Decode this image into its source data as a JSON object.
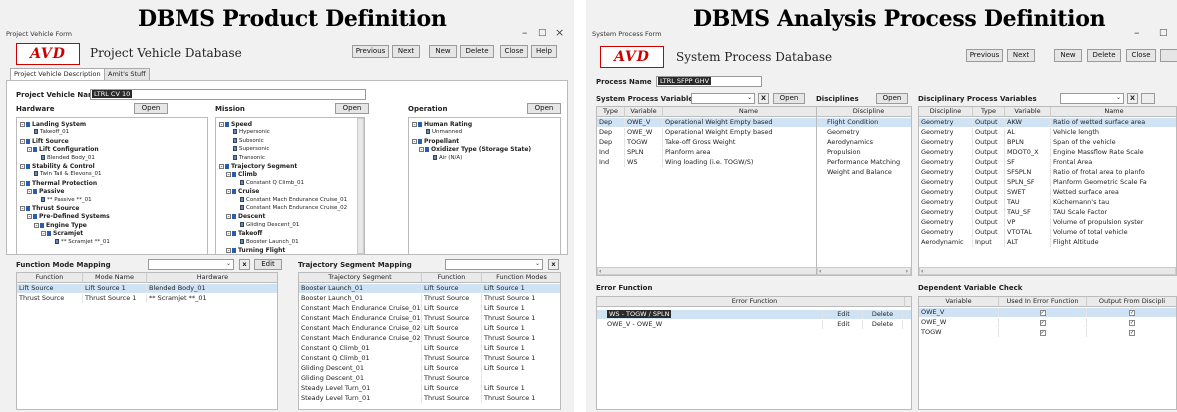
{
  "left": {
    "slide_title": "DBMS Product Definition",
    "window_title": "Project Vehicle Form",
    "logo": "AVD",
    "app_name": "Project Vehicle Database",
    "buttons": [
      "Previous",
      "Next",
      "New",
      "Delete",
      "Close",
      "Help"
    ],
    "tabs": [
      "Project Vehicle Description",
      "Amit's Stuff"
    ],
    "vehicle_name_label": "Project Vehicle Name",
    "vehicle_name_value": "LTRL CV 10",
    "hardware": {
      "label": "Hardware",
      "open": "Open",
      "nodes": [
        {
          "t": "Landing System",
          "d": 0,
          "b": true
        },
        {
          "t": "Takeoff_01",
          "d": 2,
          "b": false
        },
        {
          "t": "Lift Source",
          "d": 0,
          "b": true
        },
        {
          "t": "Lift Configuration",
          "d": 1,
          "b": true
        },
        {
          "t": "Blended Body_01",
          "d": 3,
          "b": false
        },
        {
          "t": "Stability & Control",
          "d": 0,
          "b": true
        },
        {
          "t": "Twin Tail & Elevons_01",
          "d": 2,
          "b": false
        },
        {
          "t": "Thermal Protection",
          "d": 0,
          "b": true
        },
        {
          "t": "Passive",
          "d": 1,
          "b": true
        },
        {
          "t": "** Passive **_01",
          "d": 3,
          "b": false
        },
        {
          "t": "Thrust Source",
          "d": 0,
          "b": true
        },
        {
          "t": "Pre-Defined Systems",
          "d": 1,
          "b": true
        },
        {
          "t": "Engine Type",
          "d": 2,
          "b": true
        },
        {
          "t": "Scramjet",
          "d": 3,
          "b": true
        },
        {
          "t": "** Scramjet **_01",
          "d": 5,
          "b": false
        }
      ]
    },
    "mission": {
      "label": "Mission",
      "open": "Open",
      "nodes": [
        {
          "t": "Speed",
          "d": 0,
          "b": true
        },
        {
          "t": "Hypersonic",
          "d": 2,
          "b": false
        },
        {
          "t": "Subsonic",
          "d": 2,
          "b": false
        },
        {
          "t": "Supersonic",
          "d": 2,
          "b": false
        },
        {
          "t": "Transonic",
          "d": 2,
          "b": false
        },
        {
          "t": "Trajectory Segment",
          "d": 0,
          "b": true
        },
        {
          "t": "Climb",
          "d": 1,
          "b": true
        },
        {
          "t": "Constant Q Climb_01",
          "d": 3,
          "b": false
        },
        {
          "t": "Cruise",
          "d": 1,
          "b": true
        },
        {
          "t": "Constant Mach Endurance Cruise_01",
          "d": 3,
          "b": false
        },
        {
          "t": "Constant Mach Endurance Cruise_02",
          "d": 3,
          "b": false
        },
        {
          "t": "Descent",
          "d": 1,
          "b": true
        },
        {
          "t": "Gliding Descent_01",
          "d": 3,
          "b": false
        },
        {
          "t": "Takeoff",
          "d": 1,
          "b": true
        },
        {
          "t": "Booster Launch_01",
          "d": 3,
          "b": false
        },
        {
          "t": "Turning Flight",
          "d": 1,
          "b": true
        }
      ]
    },
    "operation": {
      "label": "Operation",
      "open": "Open",
      "nodes": [
        {
          "t": "Human Rating",
          "d": 0,
          "b": true
        },
        {
          "t": "Unmanned",
          "d": 2,
          "b": false
        },
        {
          "t": "Propellant",
          "d": 0,
          "b": true
        },
        {
          "t": "Oxidizer Type (Storage State)",
          "d": 1,
          "b": true
        },
        {
          "t": "Air (N/A)",
          "d": 3,
          "b": false
        }
      ]
    },
    "fmm": {
      "label": "Function Mode Mapping",
      "x": "x",
      "edit": "Edit",
      "headers": [
        "Function",
        "Mode Name",
        "Hardware"
      ],
      "rows": [
        [
          "Lift Source",
          "Lift Source 1",
          "Blended Body_01"
        ],
        [
          "Thrust Source",
          "Thrust Source 1",
          "** Scramjet **_01"
        ]
      ]
    },
    "tsm": {
      "label": "Trajectory Segment Mapping",
      "x": "x",
      "headers": [
        "Trajectory Segment",
        "Function",
        "Function Modes"
      ],
      "rows": [
        [
          "Booster Launch_01",
          "Lift Source",
          "Lift Source 1"
        ],
        [
          "Booster Launch_01",
          "Thrust Source",
          "Thrust Source 1"
        ],
        [
          "Constant Mach Endurance Cruise_01",
          "Lift Source",
          "Lift Source 1"
        ],
        [
          "Constant Mach Endurance Cruise_01",
          "Thrust Source",
          "Thrust Source 1"
        ],
        [
          "Constant Mach Endurance Cruise_02",
          "Lift Source",
          "Lift Source 1"
        ],
        [
          "Constant Mach Endurance Cruise_02",
          "Thrust Source",
          "Thrust Source 1"
        ],
        [
          "Constant Q Climb_01",
          "Lift Source",
          "Lift Source 1"
        ],
        [
          "Constant Q Climb_01",
          "Thrust Source",
          "Thrust Source 1"
        ],
        [
          "Gliding Descent_01",
          "Lift Source",
          "Lift Source 1"
        ],
        [
          "Gliding Descent_01",
          "Thrust Source",
          ""
        ],
        [
          "Steady Level Turn_01",
          "Lift Source",
          "Lift Source 1"
        ],
        [
          "Steady Level Turn_01",
          "Thrust Source",
          "Thrust Source 1"
        ]
      ]
    }
  },
  "right": {
    "slide_title": "DBMS Analysis Process Definition",
    "window_title": "System Process Form",
    "logo": "AVD",
    "app_name": "System Process Database",
    "buttons": [
      "Previous",
      "Next",
      "New",
      "Delete",
      "Close"
    ],
    "process_name_label": "Process Name",
    "process_name_value": "LTRL SFPP GHV",
    "spv": {
      "label": "System Process Variables",
      "x": "X",
      "open": "Open",
      "headers": [
        "Type",
        "Variable",
        "Name"
      ],
      "rows": [
        [
          "Dep",
          "OWE_V",
          "Operational Weight Empty based"
        ],
        [
          "Dep",
          "OWE_W",
          "Operational Weight Empty based"
        ],
        [
          "Dep",
          "TOGW",
          "Take-off Gross Weight"
        ],
        [
          "Ind",
          "SPLN",
          "Planform area"
        ],
        [
          "Ind",
          "WS",
          "Wing loading (i.e. TOGW/S)"
        ]
      ]
    },
    "disc": {
      "label": "Disciplines",
      "open": "Open",
      "headers": [
        "Discipline"
      ],
      "rows": [
        "Flight Condition",
        "Geometry",
        "Aerodynamics",
        "Propulsion",
        "Performance Matching",
        "Weight and Balance"
      ]
    },
    "dpv": {
      "label": "Disciplinary Process Variables",
      "x": "X",
      "headers": [
        "Discipline",
        "Type",
        "Variable",
        "Name"
      ],
      "rows": [
        [
          "Geometry",
          "Output",
          "AKW",
          "Ratio of wetted surface area"
        ],
        [
          "Geometry",
          "Output",
          "AL",
          "Vehicle length"
        ],
        [
          "Geometry",
          "Output",
          "BPLN",
          "Span of the vehicle"
        ],
        [
          "Geometry",
          "Output",
          "MDOT0_X",
          "Engine Massflow Rate Scale"
        ],
        [
          "Geometry",
          "Output",
          "SF",
          "Frontal Area"
        ],
        [
          "Geometry",
          "Output",
          "SFSPLN",
          "Ratio of frotal area to planfo"
        ],
        [
          "Geometry",
          "Output",
          "SPLN_SF",
          "Planform Geometric Scale Fa"
        ],
        [
          "Geometry",
          "Output",
          "SWET",
          "Wetted surface area"
        ],
        [
          "Geometry",
          "Output",
          "TAU",
          "Küchemann's tau"
        ],
        [
          "Geometry",
          "Output",
          "TAU_SF",
          "TAU Scale Factor"
        ],
        [
          "Geometry",
          "Output",
          "VP",
          "Volume of propulsion syster"
        ],
        [
          "Geometry",
          "Output",
          "VTOTAL",
          "Volume of total vehicle"
        ],
        [
          "Aerodynamic",
          "Input",
          "ALT",
          "Flight Altitude"
        ]
      ]
    },
    "ef": {
      "label": "Error Function",
      "header": "Error Function",
      "edit": "Edit",
      "delete": "Delete",
      "rows": [
        "WS - TOGW / SPLN",
        "OWE_V - OWE_W"
      ]
    },
    "dvc": {
      "label": "Dependent Variable Check",
      "headers": [
        "Variable",
        "Used In Error Function",
        "Output From Discipli"
      ],
      "rows": [
        "OWE_V",
        "OWE_W",
        "TOGW"
      ]
    }
  }
}
